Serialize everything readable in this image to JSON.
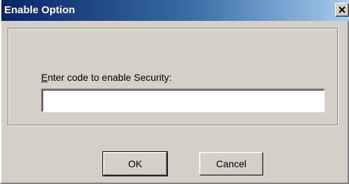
{
  "window": {
    "title": "Enable Option",
    "close_icon": "close-icon"
  },
  "form": {
    "prompt_accel": "E",
    "prompt_rest": "nter code to enable Security:",
    "code_value": ""
  },
  "buttons": {
    "ok_label": "OK",
    "cancel_label": "Cancel"
  }
}
